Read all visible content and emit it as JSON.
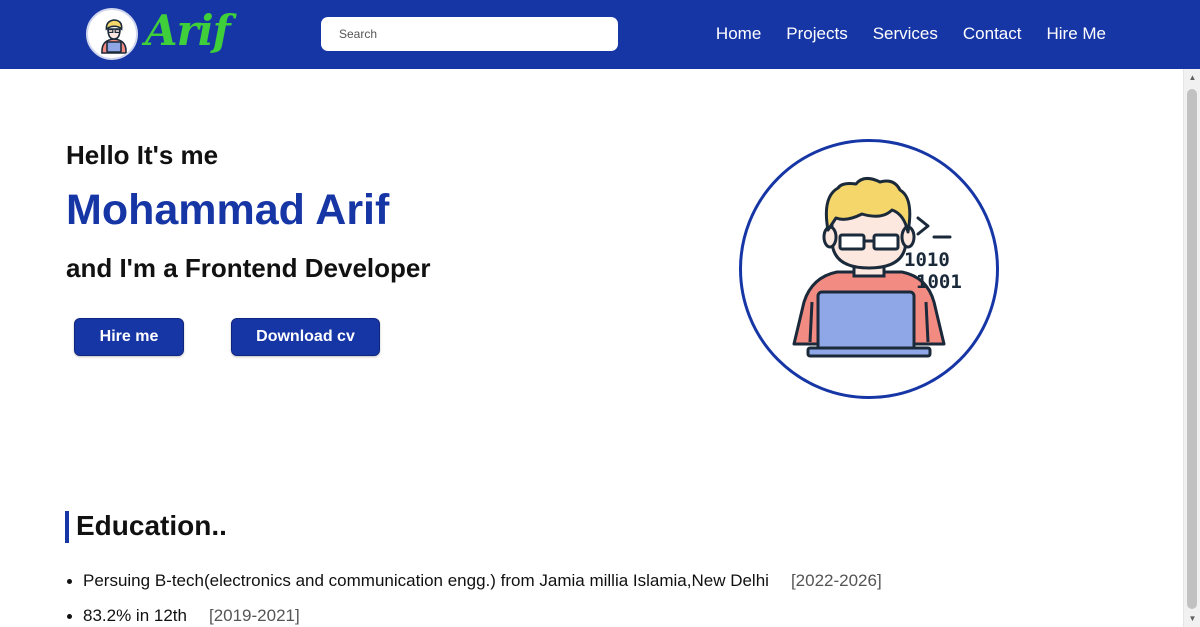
{
  "nav": {
    "logo_text": "Arif",
    "search_placeholder": "Search",
    "links": [
      "Home",
      "Projects",
      "Services",
      "Contact",
      "Hire Me"
    ]
  },
  "hero": {
    "greeting": "Hello It's me",
    "name": "Mohammad Arif",
    "role": "and I'm a Frontend Developer",
    "buttons": {
      "hire": "Hire me",
      "cv": "Download cv"
    },
    "illustration_code": [
      "1010",
      "1001"
    ]
  },
  "education": {
    "title": "Education..",
    "items": [
      {
        "text": "Persuing B-tech(electronics and communication engg.) from Jamia millia Islamia,New Delhi",
        "years": "[2022-2026]"
      },
      {
        "text": "83.2% in 12th",
        "years": "[2019-2021]"
      }
    ]
  },
  "colors": {
    "primary": "#1736a6",
    "logo_green": "#3fcf3a",
    "shirt": "#f28b82",
    "laptop": "#8fa7e6",
    "hair": "#f5d66b",
    "skin": "#fde8df"
  },
  "icons": {
    "logo": "developer-avatar-icon",
    "illustration": "developer-with-laptop-illustration"
  }
}
